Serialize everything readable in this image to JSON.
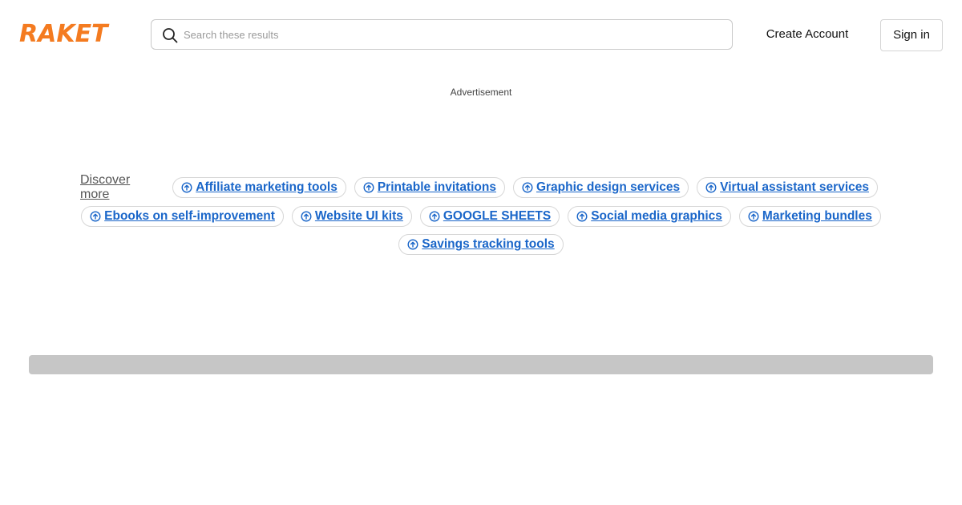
{
  "header": {
    "logo_text": "RAKET",
    "search": {
      "placeholder": "Search these results",
      "value": ""
    },
    "create_account_label": "Create Account",
    "sign_in_label": "Sign in"
  },
  "advertisement_label": "Advertisement",
  "discover": {
    "label": "Discover more",
    "rows": [
      [
        "Affiliate marketing tools",
        "Printable invitations",
        "Graphic design services",
        "Virtual assistant services"
      ],
      [
        "Ebooks on self-improvement",
        "Website UI kits",
        "GOOGLE SHEETS",
        "Social media graphics",
        "Marketing bundles"
      ],
      [
        "Savings tracking tools"
      ]
    ],
    "chip_icon": "arrow-up-circle-icon"
  },
  "colors": {
    "brand": "#f47b20",
    "link": "#1a66c9",
    "placeholder_bar": "#c6c6c6"
  }
}
